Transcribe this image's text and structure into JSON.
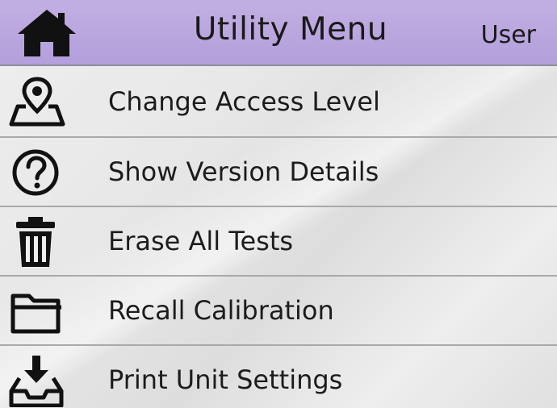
{
  "header": {
    "title": "Utility Menu",
    "user": "User",
    "home_icon": "home-icon",
    "background": "#b8a5de"
  },
  "menu": {
    "items": [
      {
        "label": "Change Access Level",
        "icon": "map-pin-icon"
      },
      {
        "label": "Show Version Details",
        "icon": "question-circle-icon"
      },
      {
        "label": "Erase All Tests",
        "icon": "trash-icon"
      },
      {
        "label": "Recall Calibration",
        "icon": "folder-icon"
      },
      {
        "label": "Print Unit Settings",
        "icon": "download-tray-icon"
      }
    ]
  }
}
